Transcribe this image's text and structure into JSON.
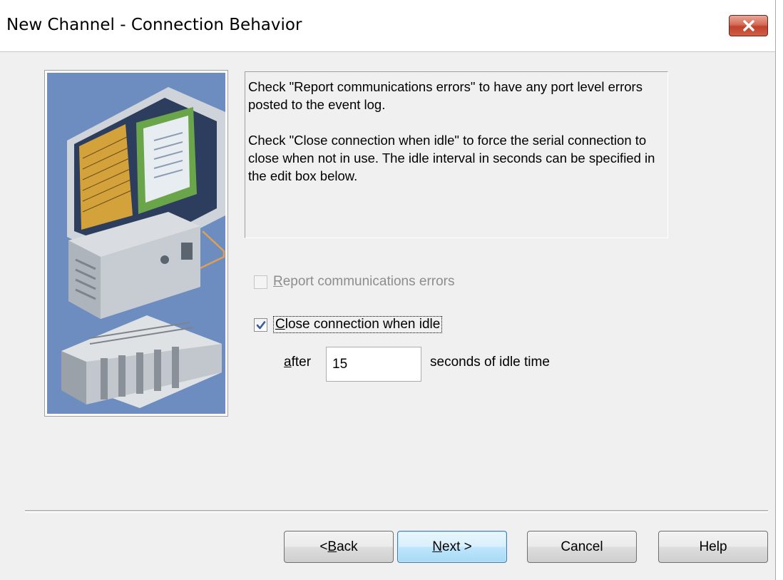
{
  "window": {
    "title": "New Channel - Connection Behavior"
  },
  "icons": {
    "close": "close-icon",
    "illustration": "computer-and-plc-illustration",
    "check": "checkmark-icon"
  },
  "colors": {
    "illustration_bg": "#6d8cc0",
    "close_button": "#c7432f",
    "default_button": "#bee6fd",
    "dialog_bg": "#f0f0f0"
  },
  "description": {
    "paragraph1": "Check \"Report communications errors\" to have any port level errors posted to the event log.",
    "paragraph2": "Check \"Close connection when idle\" to force the serial connection to close when not in use. The idle interval in seconds can be specified in the edit box below."
  },
  "options": {
    "report_errors": {
      "label_accel": "R",
      "label_rest": "eport communications errors",
      "checked": false,
      "enabled": false
    },
    "close_idle": {
      "label_accel": "C",
      "label_rest": "lose connection when idle",
      "checked": true,
      "enabled": true
    }
  },
  "idle": {
    "after_accel": "a",
    "after_rest": "fter",
    "value": "15",
    "suffix": "seconds of idle time"
  },
  "buttons": {
    "back_prefix": "< ",
    "back_accel": "B",
    "back_rest": "ack",
    "next_accel": "N",
    "next_rest": "ext >",
    "cancel": "Cancel",
    "help": "Help"
  }
}
